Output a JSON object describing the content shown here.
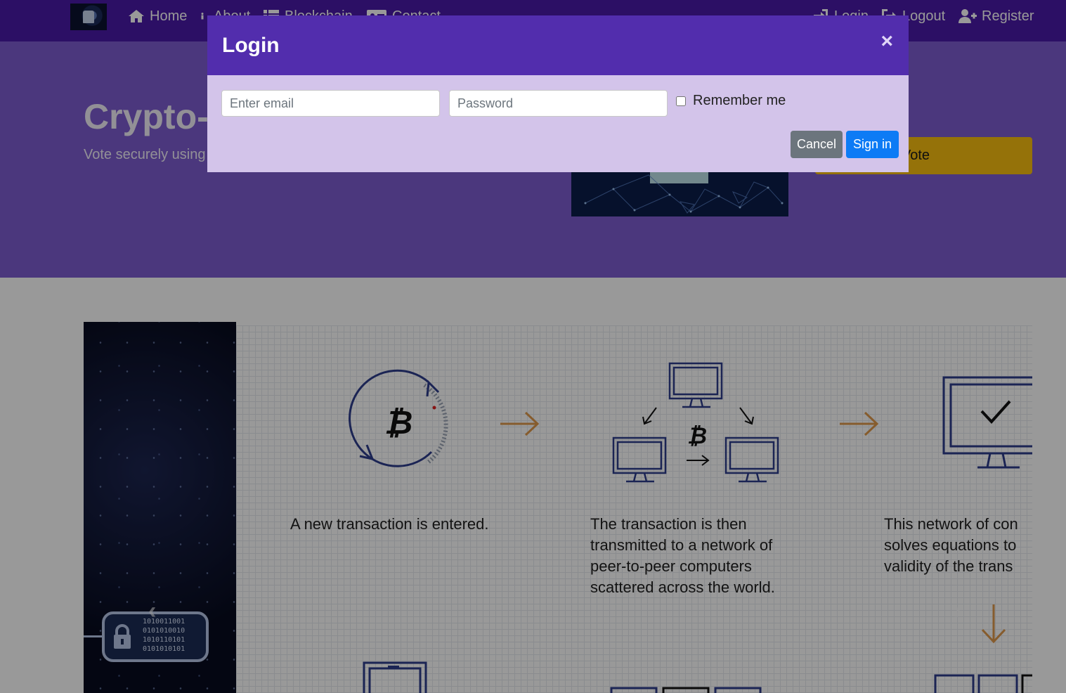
{
  "nav": {
    "brand_icon": "logo-icon",
    "left_items": [
      {
        "label": "Home",
        "icon": "home-icon"
      },
      {
        "label": "About",
        "icon": "info-icon"
      },
      {
        "label": "Blockchain",
        "icon": "list-icon"
      },
      {
        "label": "Contact",
        "icon": "id-card-icon"
      }
    ],
    "right_items": [
      {
        "label": "Login",
        "icon": "sign-in-icon"
      },
      {
        "label": "Logout",
        "icon": "sign-out-icon"
      },
      {
        "label": "Register",
        "icon": "user-plus-icon"
      }
    ]
  },
  "hero": {
    "title": "Crypto-",
    "subtitle": "Vote securely using",
    "vote_button": "Vote"
  },
  "carousel": {
    "prev": "‹",
    "next": "›",
    "steps": [
      "A new transaction is entered.",
      "The transaction is then\ntransmitted to a network of\npeer-to-peer computers\nscattered across the world.",
      "This network of con\nsolves equations to\nvalidity of the trans"
    ],
    "lock_bits": "1010011001\n0101010010\n1010110101\n0101010101"
  },
  "modal": {
    "title": "Login",
    "close": "×",
    "email_placeholder": "Enter email",
    "password_placeholder": "Password",
    "remember_label": "Remember me",
    "cancel_label": "Cancel",
    "signin_label": "Sign in"
  },
  "colors": {
    "navbar": "#4a1aa8",
    "hero": "#7d5cd1",
    "modal_header": "#522dad",
    "modal_body": "#d3c4ea",
    "vote_button": "#f9bf0f",
    "cancel_button": "#6c757d",
    "signin_button": "#0d7bf5",
    "diagram_arrow": "#e09a4c"
  }
}
